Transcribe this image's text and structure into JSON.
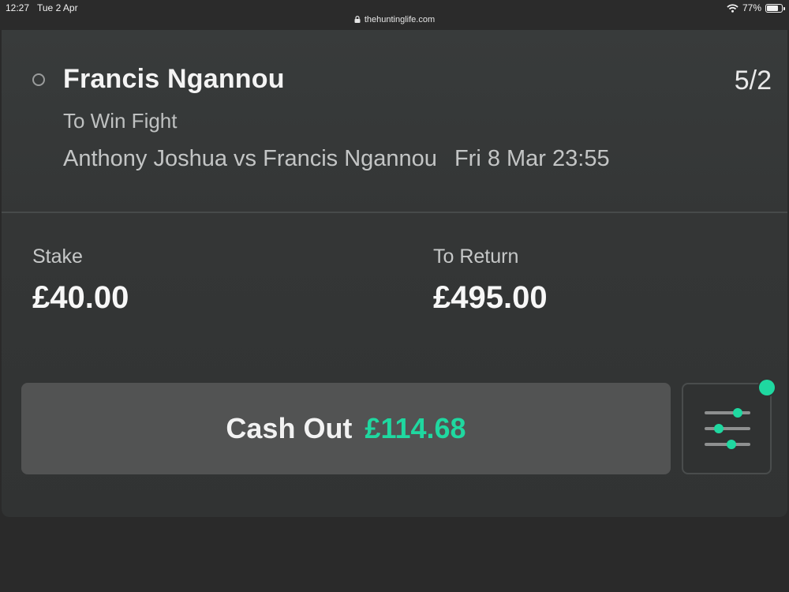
{
  "status_bar": {
    "time": "12:27",
    "date": "Tue 2 Apr",
    "url": "thehuntinglife.com",
    "battery": "77%",
    "battery_level": 0.77,
    "icons": [
      "lock-icon",
      "wifi-icon",
      "battery-icon"
    ]
  },
  "bet": {
    "selection": "Francis Ngannou",
    "odds": "5/2",
    "market": "To Win Fight",
    "event": "Anthony Joshua vs Francis Ngannou",
    "event_time": "Fri 8 Mar 23:55"
  },
  "stake": {
    "label": "Stake",
    "value": "£40.00"
  },
  "to_return": {
    "label": "To Return",
    "value": "£495.00"
  },
  "cash_out": {
    "label": "Cash Out",
    "amount": "£114.68"
  },
  "settings": {
    "icon": "sliders-icon",
    "has_notification": true
  },
  "colors": {
    "accent": "#1fd8a0",
    "card_bg": "#353838",
    "button_bg": "#525353",
    "page_bg": "#2a2a2a"
  }
}
